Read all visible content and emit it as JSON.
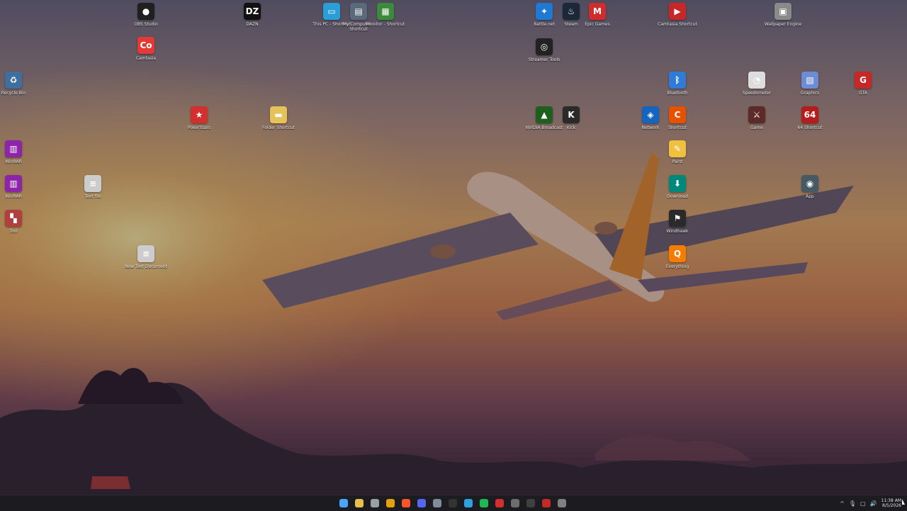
{
  "desktop": {
    "icons": [
      {
        "label": "OBS Studio",
        "icon": "obs-icon",
        "color": "#202020",
        "glyph": "●"
      },
      {
        "label": "DAZN",
        "icon": "dazn-icon",
        "color": "#111111",
        "glyph": "DZ"
      },
      {
        "label": "This PC - Shortcut",
        "icon": "this-pc-icon",
        "color": "#2a9fd6",
        "glyph": "▭"
      },
      {
        "label": "My Computer - Shortcut",
        "icon": "computer-icon",
        "color": "#5a6a7a",
        "glyph": "▤"
      },
      {
        "label": "Monitor - Shortcut",
        "icon": "monitor-icon",
        "color": "#3c8a3c",
        "glyph": "▦"
      },
      {
        "label": "Battle.net",
        "icon": "battlenet-icon",
        "color": "#1f78d1",
        "glyph": "✦"
      },
      {
        "label": "Steam",
        "icon": "steam-icon",
        "color": "#1b2838",
        "glyph": "♨"
      },
      {
        "label": "Epic Games",
        "icon": "game-client-icon",
        "color": "#d12c2c",
        "glyph": "M"
      },
      {
        "label": "Camtasia Shortcut",
        "icon": "recorder-icon",
        "color": "#c62828",
        "glyph": "▶"
      },
      {
        "label": "Wallpaper Engine",
        "icon": "photos-icon",
        "color": "#8a8a8a",
        "glyph": "▣"
      },
      {
        "label": "Camtasia",
        "icon": "camtasia-icon",
        "color": "#e53935",
        "glyph": "Co"
      },
      {
        "label": "Streamer Tools",
        "icon": "crosshair-icon",
        "color": "#222222",
        "glyph": "◎"
      },
      {
        "label": "Recycle Bin",
        "icon": "recycle-bin-icon",
        "color": "#3f6f9f",
        "glyph": "♻"
      },
      {
        "label": "Bluetooth",
        "icon": "bluetooth-icon",
        "color": "#2f7bd6",
        "glyph": "ᛒ"
      },
      {
        "label": "Speedometer",
        "icon": "speedometer-icon",
        "color": "#dddddd",
        "glyph": "◔"
      },
      {
        "label": "Graphics",
        "icon": "graphics-icon",
        "color": "#6c8cd5",
        "glyph": "▧"
      },
      {
        "label": "GTA",
        "icon": "gta-icon",
        "color": "#c62828",
        "glyph": "G"
      },
      {
        "label": "PokerStars",
        "icon": "pokerstars-icon",
        "color": "#d32f2f",
        "glyph": "★"
      },
      {
        "label": "Folder Shortcut",
        "icon": "folder-icon",
        "color": "#e6c35a",
        "glyph": "▬"
      },
      {
        "label": "NVIDIA Broadcast",
        "icon": "nvidia-icon",
        "color": "#1e5f1e",
        "glyph": "▲"
      },
      {
        "label": "Kick",
        "icon": "kick-icon",
        "color": "#2a2a2a",
        "glyph": "K"
      },
      {
        "label": "Network",
        "icon": "network-icon",
        "color": "#1565c0",
        "glyph": "◈"
      },
      {
        "label": "Shortcut",
        "icon": "ccleaner-icon",
        "color": "#e65100",
        "glyph": "C"
      },
      {
        "label": "Game",
        "icon": "game-icon",
        "color": "#5d2a2a",
        "glyph": "⚔"
      },
      {
        "label": "64 Shortcut",
        "icon": "aida64-icon",
        "color": "#b71c1c",
        "glyph": "64"
      },
      {
        "label": "WinRAR",
        "icon": "winrar-icon",
        "color": "#8e24aa",
        "glyph": "▥"
      },
      {
        "label": "Paint",
        "icon": "paint-icon",
        "color": "#f0c040",
        "glyph": "✎"
      },
      {
        "label": "WinRAR",
        "icon": "winrar-icon",
        "color": "#8e24aa",
        "glyph": "▥"
      },
      {
        "label": "Text file",
        "icon": "text-file-icon",
        "color": "#cccccc",
        "glyph": "≡"
      },
      {
        "label": "Download",
        "icon": "download-icon",
        "color": "#00897b",
        "glyph": "⬇"
      },
      {
        "label": "App",
        "icon": "app-icon",
        "color": "#455a64",
        "glyph": "◉"
      },
      {
        "label": "Tool",
        "icon": "tool-icon",
        "color": "#b04040",
        "glyph": "▚"
      },
      {
        "label": "Windhawk",
        "icon": "windhawk-icon",
        "color": "#2a2a2a",
        "glyph": "⚑"
      },
      {
        "label": "New Text Document",
        "icon": "text-file-icon",
        "color": "#cccccc",
        "glyph": "≡"
      },
      {
        "label": "Everything",
        "icon": "search-app-icon",
        "color": "#f57c00",
        "glyph": "Q"
      }
    ]
  },
  "taskbar": {
    "items": [
      {
        "icon": "start-icon",
        "color": "#4aa3ff"
      },
      {
        "icon": "file-explorer-icon",
        "color": "#e8c04a"
      },
      {
        "icon": "settings-icon",
        "color": "#9aa0a6"
      },
      {
        "icon": "chrome-icon",
        "color": "#e5a00d"
      },
      {
        "icon": "brave-icon",
        "color": "#fb542b"
      },
      {
        "icon": "discord-icon",
        "color": "#5865f2"
      },
      {
        "icon": "browser-icon",
        "color": "#7f8c9a"
      },
      {
        "icon": "obs-icon",
        "color": "#333333"
      },
      {
        "icon": "telegram-icon",
        "color": "#2aa3e0"
      },
      {
        "icon": "spotify-icon",
        "color": "#1db954"
      },
      {
        "icon": "opera-icon",
        "color": "#d32f2f"
      },
      {
        "icon": "notes-icon",
        "color": "#6d6d6d"
      },
      {
        "icon": "game-bar-icon",
        "color": "#404040"
      },
      {
        "icon": "record-icon",
        "color": "#c62828"
      },
      {
        "icon": "app-icon",
        "color": "#808080"
      }
    ]
  },
  "tray": {
    "time": "11:38 AM",
    "date": "8/5/2026"
  }
}
